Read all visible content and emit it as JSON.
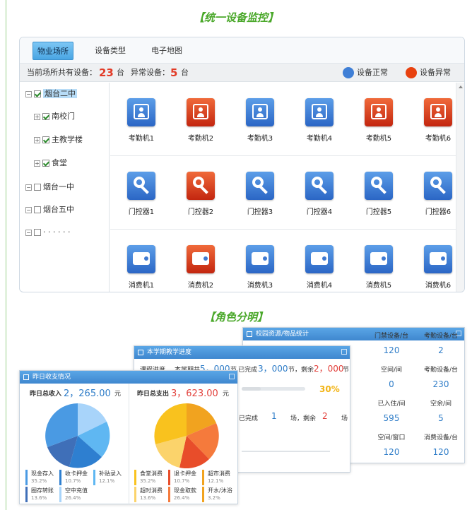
{
  "section1_title": "【统一设备监控】",
  "section2_title": "【角色分明】",
  "tabs": [
    "物业场所",
    "设备类型",
    "电子地图"
  ],
  "info": {
    "total_label": "当前场所共有设备：",
    "total_value": "23",
    "unit": "台",
    "abnormal_label": "异常设备：",
    "abnormal_value": "5",
    "normal_legend": "设备正常",
    "abnormal_legend": "设备异常"
  },
  "colors": {
    "normal": "#3f7fd6",
    "abnormal": "#e8410f",
    "accent": "#4aa82a"
  },
  "tree": [
    {
      "label": "烟台二中",
      "level": 0,
      "expander": "−",
      "checked": true,
      "selected": true
    },
    {
      "label": "南校门",
      "level": 1,
      "expander": "+",
      "checked": true
    },
    {
      "label": "主教学楼",
      "level": 1,
      "expander": "+",
      "checked": true
    },
    {
      "label": "食堂",
      "level": 1,
      "expander": "+",
      "checked": true
    },
    {
      "label": "烟台一中",
      "level": 0,
      "expander": "−",
      "checked": false
    },
    {
      "label": "烟台五中",
      "level": 0,
      "expander": "−",
      "checked": false
    },
    {
      "label": "· · ·  · · ·",
      "level": 0,
      "expander": "−",
      "checked": false
    }
  ],
  "device_rows": [
    {
      "icon": "attendance-icon",
      "items": [
        {
          "label": "考勤机1",
          "status": "normal"
        },
        {
          "label": "考勤机2",
          "status": "abnormal"
        },
        {
          "label": "考勤机3",
          "status": "normal"
        },
        {
          "label": "考勤机4",
          "status": "normal"
        },
        {
          "label": "考勤机5",
          "status": "abnormal"
        },
        {
          "label": "考勤机6",
          "status": "abnormal"
        }
      ]
    },
    {
      "icon": "key-icon",
      "items": [
        {
          "label": "门控器1",
          "status": "normal"
        },
        {
          "label": "门控器2",
          "status": "abnormal"
        },
        {
          "label": "门控器3",
          "status": "normal"
        },
        {
          "label": "门控器4",
          "status": "normal"
        },
        {
          "label": "门控器5",
          "status": "normal"
        },
        {
          "label": "门控器6",
          "status": "normal"
        }
      ]
    },
    {
      "icon": "wallet-icon",
      "items": [
        {
          "label": "消费机1",
          "status": "normal"
        },
        {
          "label": "消费机2",
          "status": "abnormal"
        },
        {
          "label": "消费机3",
          "status": "normal"
        },
        {
          "label": "消费机4",
          "status": "normal"
        },
        {
          "label": "消费机5",
          "status": "normal"
        },
        {
          "label": "消费机6",
          "status": "normal"
        }
      ]
    }
  ],
  "win_income": {
    "title": "昨日收支情况",
    "income_label": "昨日总收入",
    "income_value": "2，265.00",
    "income_unit": "元",
    "expense_label": "昨日总支出",
    "expense_value": "3，623.00",
    "expense_unit": "元",
    "income_legend": [
      {
        "name": "现金存入",
        "pct": "35.2%"
      },
      {
        "name": "收卡押金",
        "pct": "10.7%"
      },
      {
        "name": "补贴录入",
        "pct": "12.1%"
      },
      {
        "name": "圈存转账",
        "pct": "13.6%"
      },
      {
        "name": "空中充值",
        "pct": "26.4%"
      }
    ],
    "expense_legend": [
      {
        "name": "食堂消费",
        "pct": "35.2%"
      },
      {
        "name": "退卡押金",
        "pct": "10.7%"
      },
      {
        "name": "超市消费",
        "pct": "12.1%"
      },
      {
        "name": "超时消费",
        "pct": "13.6%"
      },
      {
        "name": "现金取款",
        "pct": "26.4%"
      },
      {
        "name": "开水/沐浴",
        "pct": "3.2%"
      }
    ]
  },
  "win_progress": {
    "title": "本学期教学进度",
    "row1_label": "课程进度",
    "term_label": "本学期共",
    "term_value": "5，000",
    "term_unit": "节",
    "done_label": "已完成",
    "done_value": "3，000",
    "remain_label": "节，剩余",
    "remain_value": "2，000",
    "remain_unit": "节",
    "percent": "30%",
    "row2_done_label": "已完成",
    "row2_done_value": "1",
    "row2_unit": "场，剩余",
    "row2_remain_value": "2",
    "row2_unit2": "场"
  },
  "win_dorm": {
    "title": "校园资源/物品统计",
    "cells": [
      {
        "h": "门禁设备/台",
        "v": "120"
      },
      {
        "h": "考勤设备/台",
        "v": "2"
      },
      {
        "h": "空间/间",
        "v": "0"
      },
      {
        "h": "考勤设备/台",
        "v": "230"
      },
      {
        "h": "已入住/间",
        "v": "595"
      },
      {
        "h": "空余/间",
        "v": "5"
      },
      {
        "h": "空间/窗口",
        "v": "120"
      },
      {
        "h": "消费设备/台",
        "v": "120"
      }
    ]
  }
}
